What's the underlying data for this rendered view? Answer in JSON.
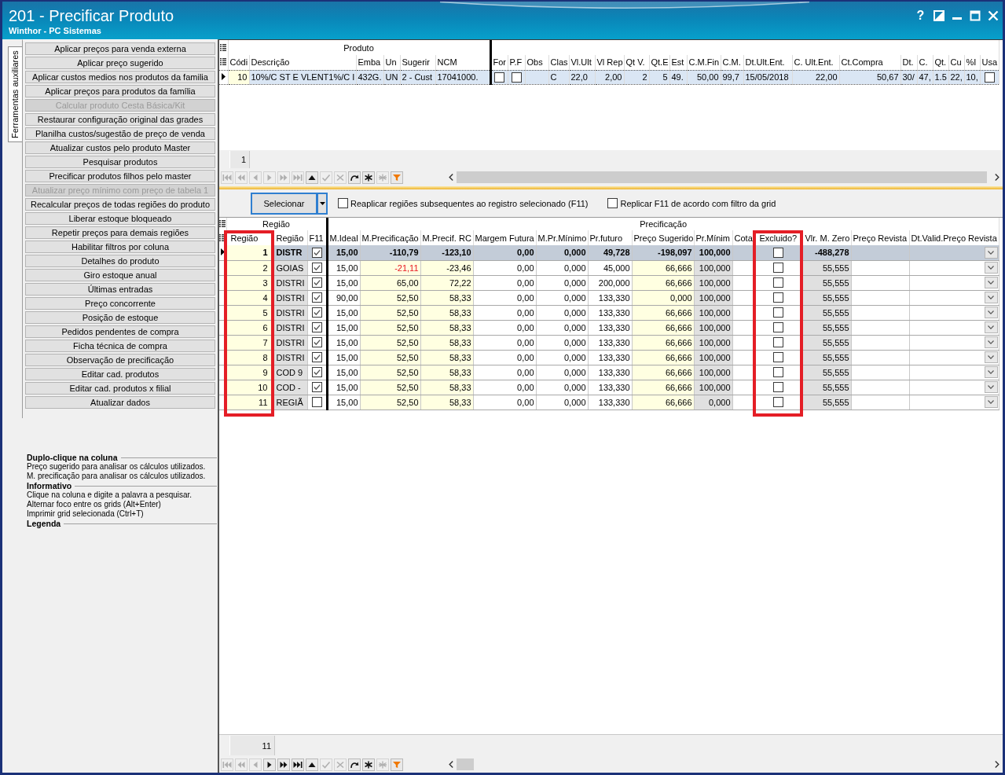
{
  "window": {
    "title": "201 - Precificar Produto",
    "subtitle": "Winthor - PC Sistemas",
    "buttons": [
      {
        "kind": "help",
        "label": "?"
      },
      {
        "kind": "dock"
      },
      {
        "kind": "minimize"
      },
      {
        "kind": "maximize"
      },
      {
        "kind": "close"
      }
    ]
  },
  "side_tabs": [
    {
      "label": "Ferramentas auxiliares",
      "selected": true
    }
  ],
  "tools": [
    {
      "label": "Aplicar preços para venda externa",
      "disabled": false
    },
    {
      "label": "Aplicar preço sugerido",
      "disabled": false
    },
    {
      "label": "Aplicar custos medios nos produtos da familia",
      "disabled": false
    },
    {
      "label": "Aplicar preços para produtos da família",
      "disabled": false
    },
    {
      "label": "Calcular produto Cesta Básica/Kit",
      "disabled": true
    },
    {
      "label": "Restaurar configuração original das grades",
      "disabled": false
    },
    {
      "label": "Planilha custos/sugestão de preço de venda",
      "disabled": false
    },
    {
      "label": "Atualizar custos pelo produto Master",
      "disabled": false
    },
    {
      "label": "Pesquisar produtos",
      "disabled": false
    },
    {
      "label": "Precificar produtos filhos pelo master",
      "disabled": false
    },
    {
      "label": "Atualizar preço mínimo com preço de tabela 1",
      "disabled": true
    },
    {
      "label": "Recalcular preços de todas regiões do produto",
      "disabled": false
    },
    {
      "label": "Liberar estoque bloqueado",
      "disabled": false
    },
    {
      "label": "Repetir preços para demais regiões",
      "disabled": false
    },
    {
      "label": "Habilitar filtros por coluna",
      "disabled": false
    },
    {
      "label": "Detalhes do produto",
      "disabled": false
    },
    {
      "label": "Giro estoque anual",
      "disabled": false
    },
    {
      "label": "Últimas entradas",
      "disabled": false
    },
    {
      "label": "Preço concorrente",
      "disabled": false
    },
    {
      "label": "Posição de estoque",
      "disabled": false
    },
    {
      "label": "Pedidos pendentes de compra",
      "disabled": false
    },
    {
      "label": "Ficha técnica de compra",
      "disabled": false
    },
    {
      "label": "Observação de precificação",
      "disabled": false
    },
    {
      "label": "Editar cad. produtos",
      "disabled": false
    },
    {
      "label": "Editar cad. produtos x filial",
      "disabled": false
    },
    {
      "label": "Atualizar dados",
      "disabled": false
    }
  ],
  "help_sections": [
    {
      "title": "Duplo-clique na coluna",
      "lines": [
        "Preço sugerido para analisar os cálculos utilizados.",
        "M. precificação para analisar os cálculos utilizados."
      ]
    },
    {
      "title": "Informativo",
      "lines": [
        "Clique na coluna e digite a palavra a pesquisar.",
        "Alternar foco entre os grids (Alt+Enter)",
        "Imprimir grid selecionada (Ctrl+T)"
      ]
    },
    {
      "title": "Legenda"
    }
  ],
  "product_grid": {
    "groups": [
      {
        "label": "Produto",
        "columns": [
          {
            "label": "Códi",
            "kind": "key"
          },
          {
            "label": "Descrição",
            "kind": "text"
          },
          {
            "label": "Emba",
            "kind": "text"
          },
          {
            "label": "Un",
            "kind": "text"
          },
          {
            "label": "Sugerir",
            "kind": "text"
          },
          {
            "label": "NCM",
            "kind": "text"
          }
        ]
      },
      {
        "columns": [
          {
            "label": "For",
            "kind": "check"
          },
          {
            "label": "P.F",
            "kind": "check"
          },
          {
            "label": "Obs",
            "kind": "text"
          },
          {
            "label": "Clas",
            "kind": "text"
          },
          {
            "label": "Vl.Ult",
            "kind": "text"
          },
          {
            "label": "Vl Rep",
            "kind": "number"
          },
          {
            "label": "Qt V.",
            "kind": "number"
          },
          {
            "label": "Qt.E",
            "kind": "number"
          },
          {
            "label": "Est",
            "kind": "text"
          },
          {
            "label": "C.M.Fin",
            "kind": "number"
          },
          {
            "label": "C.M.",
            "kind": "text"
          },
          {
            "label": "Dt.Ult.Ent.",
            "kind": "text"
          },
          {
            "label": "C. Ult.Ent.",
            "kind": "number"
          },
          {
            "label": "Ct.Compra",
            "kind": "number"
          },
          {
            "label": "Dt.",
            "kind": "text"
          },
          {
            "label": "C.",
            "kind": "text"
          },
          {
            "label": "Qt.",
            "kind": "text"
          },
          {
            "label": "Cu",
            "kind": "text"
          },
          {
            "label": "%I",
            "kind": "text"
          },
          {
            "label": "Usa",
            "kind": "check"
          }
        ]
      }
    ],
    "rows": [
      {
        "selected": true,
        "cells": [
          "10",
          "10%/C ST E VLENT1%/C I",
          "432G.",
          "UN",
          "2 - Cust",
          "17041000.",
          false,
          false,
          null,
          "C",
          "22,0",
          "2,00",
          "2",
          "5",
          "49.",
          "50,00",
          "99,7",
          "15/05/2018",
          "22,00",
          "50,67",
          "30/",
          "47,",
          "1.5",
          "22,",
          "10,",
          false
        ]
      }
    ],
    "count": "1",
    "navigator": [
      {
        "kind": "first",
        "disabled": true
      },
      {
        "kind": "prior_page",
        "disabled": true
      },
      {
        "kind": "prior",
        "disabled": true
      },
      {
        "kind": "next",
        "disabled": true
      },
      {
        "kind": "next_page",
        "disabled": true
      },
      {
        "kind": "last",
        "disabled": true
      },
      {
        "kind": "edit",
        "disabled": false
      },
      {
        "kind": "post",
        "disabled": true
      },
      {
        "kind": "cancel",
        "disabled": true
      },
      {
        "kind": "refresh",
        "disabled": false
      },
      {
        "kind": "bookmark",
        "disabled": false
      },
      {
        "kind": "goto_bookmark",
        "disabled": true
      },
      {
        "kind": "filter",
        "disabled": false
      }
    ]
  },
  "options": {
    "select_button": {
      "label": "Selecionar",
      "focused": true
    },
    "checkboxes": [
      {
        "label": "Reaplicar regiões subsequentes ao registro selecionado (F11)",
        "checked": false
      },
      {
        "label": "Replicar F11 de acordo com filtro da grid",
        "checked": false
      }
    ]
  },
  "region_grid": {
    "groups": [
      {
        "label": "Região",
        "columns": [
          {
            "label": "Região",
            "kind": "key",
            "highlighted": true
          },
          {
            "label": "Região",
            "kind": "name",
            "highlighted": false
          },
          {
            "label": "F11",
            "kind": "check",
            "highlighted": false
          }
        ]
      },
      {
        "label": "Precificação",
        "columns": [
          {
            "label": "M.Ideal",
            "kind": "number",
            "highlighted": false
          },
          {
            "label": "M.Precificação",
            "kind": "entry",
            "highlighted": false
          },
          {
            "label": "M.Precif. RC",
            "kind": "entry",
            "highlighted": false
          },
          {
            "label": "Margem Futura",
            "kind": "number",
            "highlighted": false
          },
          {
            "label": "M.Pr.Mínimo",
            "kind": "number",
            "highlighted": false
          },
          {
            "label": "Pr.futuro",
            "kind": "number",
            "highlighted": false
          },
          {
            "label": "Preço Sugerido",
            "kind": "entry",
            "highlighted": false
          },
          {
            "label": "Pr.Mínim",
            "kind": "locked",
            "highlighted": false
          },
          {
            "label": "Cota",
            "kind": "number",
            "highlighted": false
          },
          {
            "label": "Excluido?",
            "kind": "check",
            "highlighted": true
          },
          {
            "label": "Vlr. M. Zero",
            "kind": "locked",
            "highlighted": false
          },
          {
            "label": "Preço Revista",
            "kind": "number",
            "highlighted": false
          },
          {
            "label": "Dt.Valid.Preço Revista",
            "kind": "combo",
            "highlighted": false
          }
        ]
      }
    ],
    "rows": [
      {
        "selected": true,
        "cells": [
          "1",
          "DISTR",
          true,
          "15,00",
          "-110,79",
          "-123,10",
          "0,00",
          "0,000",
          "49,728",
          "-198,097",
          "100,000",
          null,
          false,
          "-488,278",
          null,
          null
        ]
      },
      {
        "selected": false,
        "cells": [
          "2",
          "GOIAS",
          true,
          "15,00",
          {
            "text": "-21,11",
            "alert": true
          },
          "-23,46",
          "0,00",
          "0,000",
          "45,000",
          "66,666",
          "100,000",
          null,
          false,
          "55,555",
          null,
          null
        ]
      },
      {
        "selected": false,
        "cells": [
          "3",
          "DISTRI",
          true,
          "15,00",
          "65,00",
          "72,22",
          "0,00",
          "0,000",
          "200,000",
          "66,666",
          "100,000",
          null,
          false,
          "55,555",
          null,
          null
        ]
      },
      {
        "selected": false,
        "cells": [
          "4",
          "DISTRI",
          true,
          "90,00",
          "52,50",
          "58,33",
          "0,00",
          "0,000",
          "133,330",
          "0,000",
          "100,000",
          null,
          false,
          "55,555",
          null,
          null
        ]
      },
      {
        "selected": false,
        "cells": [
          "5",
          "DISTRI",
          true,
          "15,00",
          "52,50",
          "58,33",
          "0,00",
          "0,000",
          "133,330",
          "66,666",
          "100,000",
          null,
          false,
          "55,555",
          null,
          null
        ]
      },
      {
        "selected": false,
        "cells": [
          "6",
          "DISTRI",
          true,
          "15,00",
          "52,50",
          "58,33",
          "0,00",
          "0,000",
          "133,330",
          "66,666",
          "100,000",
          null,
          false,
          "55,555",
          null,
          null
        ]
      },
      {
        "selected": false,
        "cells": [
          "7",
          "DISTRI",
          true,
          "15,00",
          "52,50",
          "58,33",
          "0,00",
          "0,000",
          "133,330",
          "66,666",
          "100,000",
          null,
          false,
          "55,555",
          null,
          null
        ]
      },
      {
        "selected": false,
        "cells": [
          "8",
          "DISTRI",
          true,
          "15,00",
          "52,50",
          "58,33",
          "0,00",
          "0,000",
          "133,330",
          "66,666",
          "100,000",
          null,
          false,
          "55,555",
          null,
          null
        ]
      },
      {
        "selected": false,
        "cells": [
          "9",
          "COD 9",
          true,
          "15,00",
          "52,50",
          "58,33",
          "0,00",
          "0,000",
          "133,330",
          "66,666",
          "100,000",
          null,
          false,
          "55,555",
          null,
          null
        ]
      },
      {
        "selected": false,
        "cells": [
          "10",
          "COD -",
          true,
          "15,00",
          "52,50",
          "58,33",
          "0,00",
          "0,000",
          "133,330",
          "66,666",
          "100,000",
          null,
          false,
          "55,555",
          null,
          null
        ]
      },
      {
        "selected": false,
        "cells": [
          "11",
          "REGIÃ",
          false,
          "15,00",
          "52,50",
          "58,33",
          "0,00",
          "0,000",
          "133,330",
          "66,666",
          "0,000",
          null,
          false,
          "55,555",
          null,
          null
        ]
      }
    ],
    "count": "11",
    "navigator": [
      {
        "kind": "first",
        "disabled": true
      },
      {
        "kind": "prior_page",
        "disabled": true
      },
      {
        "kind": "prior",
        "disabled": true
      },
      {
        "kind": "next",
        "disabled": false
      },
      {
        "kind": "next_page",
        "disabled": false
      },
      {
        "kind": "last",
        "disabled": false
      },
      {
        "kind": "edit",
        "disabled": false
      },
      {
        "kind": "post",
        "disabled": true
      },
      {
        "kind": "cancel",
        "disabled": true
      },
      {
        "kind": "refresh",
        "disabled": false
      },
      {
        "kind": "bookmark",
        "disabled": false
      },
      {
        "kind": "goto_bookmark",
        "disabled": true
      },
      {
        "kind": "filter",
        "disabled": false
      }
    ]
  }
}
